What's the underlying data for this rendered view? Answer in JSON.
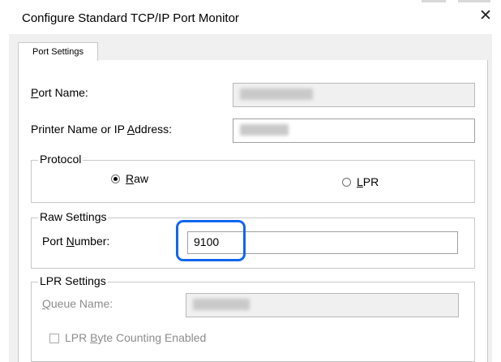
{
  "window": {
    "title": "Configure Standard TCP/IP Port Monitor",
    "close_glyph": "✕"
  },
  "tabs": [
    {
      "label": "Port Settings"
    }
  ],
  "port_name": {
    "label_prefix": "",
    "mnemonic": "P",
    "label_suffix": "ort Name:"
  },
  "printer_name": {
    "label_prefix": "Printer Name or IP ",
    "mnemonic": "A",
    "label_suffix": "ddress:"
  },
  "protocol": {
    "legend": "Protocol",
    "raw": {
      "mnemonic": "R",
      "label_suffix": "aw",
      "checked": true
    },
    "lpr": {
      "mnemonic": "L",
      "label_suffix": "PR",
      "checked": false
    }
  },
  "raw_settings": {
    "legend": "Raw Settings",
    "port_number": {
      "label_prefix": "Port ",
      "mnemonic": "N",
      "label_suffix": "umber:",
      "value": "9100"
    }
  },
  "lpr_settings": {
    "legend": "LPR Settings",
    "queue_name": {
      "mnemonic": "Q",
      "label_suffix": "ueue Name:"
    },
    "byte_counting": {
      "label_prefix": "LPR ",
      "mnemonic": "B",
      "label_suffix": "yte Counting Enabled",
      "checked": false
    }
  },
  "colors": {
    "highlight": "#1166ee",
    "background": "#f0f0f0"
  }
}
